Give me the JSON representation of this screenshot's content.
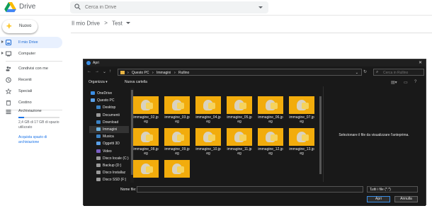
{
  "header": {
    "brand": "Drive",
    "search_placeholder": "Cerca in Drive"
  },
  "new_button": {
    "label": "Nuovo"
  },
  "nav": {
    "items": [
      {
        "label": "Il mio Drive",
        "icon": "my-drive-icon"
      },
      {
        "label": "Computer",
        "icon": "computer-icon"
      },
      {
        "label": "Condivisi con me",
        "icon": "shared-icon"
      },
      {
        "label": "Recenti",
        "icon": "clock-icon"
      },
      {
        "label": "Speciali",
        "icon": "star-icon"
      },
      {
        "label": "Cestino",
        "icon": "trash-icon"
      }
    ],
    "storage": {
      "label": "Archiviazione",
      "used_text": "2,4 GB di 17 GB di spazio utilizzato",
      "used_fraction": 0.14,
      "buy_link": "Acquista spazio di archiviazione"
    }
  },
  "breadcrumb": {
    "root": "Il mio Drive",
    "current": "Test",
    "separator": ">"
  },
  "dialog": {
    "title": "Apri",
    "close": "✕",
    "path": [
      "Questo PC",
      "Immagini",
      "Rullino"
    ],
    "search_placeholder": "Cerca in Rullino",
    "toolbar": {
      "organize": "Organizza ▾",
      "new_folder": "Nuova cartella"
    },
    "tree": [
      {
        "label": "OneDrive",
        "color": "#3a8ee6",
        "indent": 0
      },
      {
        "label": "Questo PC",
        "color": "#5aa0e8",
        "indent": 0
      },
      {
        "label": "Desktop",
        "color": "#3b82c4",
        "indent": 1
      },
      {
        "label": "Documenti",
        "color": "#9a9a9a",
        "indent": 1
      },
      {
        "label": "Download",
        "color": "#3b82c4",
        "indent": 1
      },
      {
        "label": "Immagini",
        "color": "#6fb3e0",
        "indent": 1,
        "selected": true
      },
      {
        "label": "Musica",
        "color": "#3b82c4",
        "indent": 1
      },
      {
        "label": "Oggetti 3D",
        "color": "#5aa0e8",
        "indent": 1
      },
      {
        "label": "Video",
        "color": "#7a5fc4",
        "indent": 1
      },
      {
        "label": "Disco locale (C:)",
        "color": "#9a9a9a",
        "indent": 1
      },
      {
        "label": "Backup (D:)",
        "color": "#9a9a9a",
        "indent": 1
      },
      {
        "label": "Disco Installaz",
        "color": "#9a9a9a",
        "indent": 1
      },
      {
        "label": "Disco SSD (F:)",
        "color": "#9a9a9a",
        "indent": 1
      },
      {
        "label": "Rete",
        "color": "#5aa0e8",
        "indent": 0
      }
    ],
    "files": [
      "immagine_02.jpeg",
      "immagine_03.jpeg",
      "immagine_04.jpeg",
      "immagine_05.jpeg",
      "immagine_06.jpeg",
      "immagine_07.jpeg",
      "immagine_08.jpeg",
      "immagine_09.jpeg",
      "immagine_10.jpeg",
      "immagine_11.jpeg",
      "immagine_12.jpeg",
      "immagine_13.jpeg",
      "",
      ""
    ],
    "preview_text": "Selezionare il file da visualizzare l'anteprima.",
    "filename_label": "Nome file:",
    "filename_value": "",
    "filetype": "Tutti i file (*.*)",
    "open_button": "Apri",
    "cancel_button": "Annulla"
  },
  "colors": {
    "thumb_bg": "#f2ac0c",
    "accent": "#1a73e8"
  }
}
